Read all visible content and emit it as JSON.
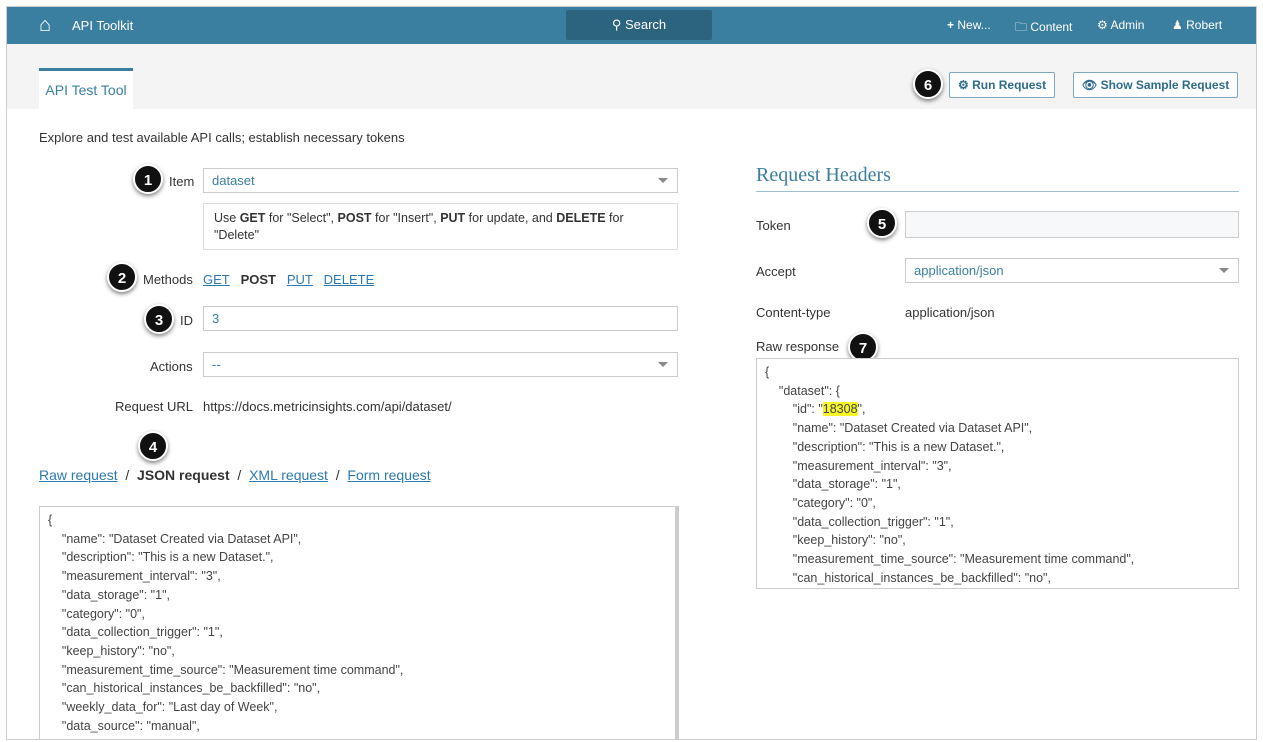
{
  "header": {
    "app_title": "API Toolkit",
    "search_label": "Search",
    "new_label": "New...",
    "content_label": "Content",
    "admin_label": "Admin",
    "user_label": "Robert"
  },
  "tab": {
    "label": "API Test Tool"
  },
  "toolbar": {
    "run_label": "Run Request",
    "sample_label": "Show Sample Request"
  },
  "intro": "Explore and test available API calls; establish necessary tokens",
  "form": {
    "item_label": "Item",
    "item_value": "dataset",
    "hint_parts": [
      "Use ",
      "GET",
      " for \"Select\", ",
      "POST",
      " for \"Insert\", ",
      "PUT",
      " for update, and ",
      "DELETE",
      " for \"Delete\""
    ],
    "methods_label": "Methods",
    "methods": [
      "GET",
      "POST",
      "PUT",
      "DELETE"
    ],
    "active_method": "POST",
    "id_label": "ID",
    "id_value": "3",
    "actions_label": "Actions",
    "actions_value": "--",
    "url_label": "Request URL",
    "url_value": "https://docs.metricinsights.com/api/dataset/"
  },
  "request_tabs": {
    "raw": "Raw request",
    "json": "JSON request",
    "xml": "XML request",
    "form": "Form request",
    "sep": "/"
  },
  "json_request": "{\n    \"name\": \"Dataset Created via Dataset API\",\n    \"description\": \"This is a new Dataset.\",\n    \"measurement_interval\": \"3\",\n    \"data_storage\": \"1\",\n    \"category\": \"0\",\n    \"data_collection_trigger\": \"1\",\n    \"keep_history\": \"no\",\n    \"measurement_time_source\": \"Measurement time command\",\n    \"can_historical_instances_be_backfilled\": \"no\",\n    \"weekly_data_for\": \"Last day of Week\",\n    \"data_source\": \"manual\",",
  "headers": {
    "title": "Request Headers",
    "token_label": "Token",
    "token_value": "",
    "accept_label": "Accept",
    "accept_value": "application/json",
    "content_type_label": "Content-type",
    "content_type_value": "application/json",
    "raw_label": "Raw response"
  },
  "raw_response": {
    "before": "{\n    \"dataset\": {\n        \"id\": \"",
    "id": "18308",
    "after": "\",\n        \"name\": \"Dataset Created via Dataset API\",\n        \"description\": \"This is a new Dataset.\",\n        \"measurement_interval\": \"3\",\n        \"data_storage\": \"1\",\n        \"category\": \"0\",\n        \"data_collection_trigger\": \"1\",\n        \"keep_history\": \"no\",\n        \"measurement_time_source\": \"Measurement time command\",\n        \"can_historical_instances_be_backfilled\": \"no\","
  },
  "callouts": [
    "1",
    "2",
    "3",
    "4",
    "5",
    "6",
    "7"
  ],
  "colors": {
    "header": "#3a7fa0",
    "link": "#2d7ab0",
    "highlight": "#f5f52a"
  }
}
